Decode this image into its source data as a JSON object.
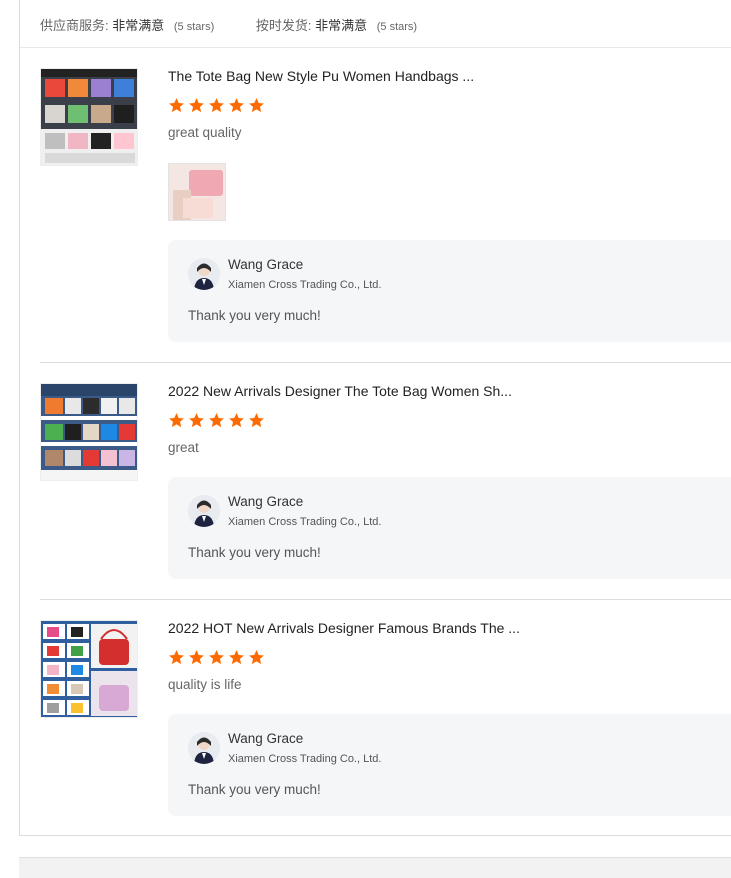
{
  "summary": {
    "supplier_service_label": "供应商服务:",
    "supplier_service_value": "非常满意",
    "supplier_service_note": "(5 stars)",
    "shipping_label": "按时发货:",
    "shipping_value": "非常满意",
    "shipping_note": "(5 stars)"
  },
  "colors": {
    "star": "#ff6a00",
    "reply_bg": "#f4f6f8"
  },
  "reviews": [
    {
      "product_title": "The Tote Bag New Style Pu Women Handbags ...",
      "rating": 5,
      "comment": "great quality",
      "reply": {
        "name": "Wang Grace",
        "company": "Xiamen Cross Trading Co., Ltd.",
        "text": "Thank you very much!"
      }
    },
    {
      "product_title": "2022 New Arrivals Designer The Tote Bag Women Sh...",
      "rating": 5,
      "comment": "great",
      "reply": {
        "name": "Wang Grace",
        "company": "Xiamen Cross Trading Co., Ltd.",
        "text": "Thank you very much!"
      }
    },
    {
      "product_title": "2022 HOT New Arrivals Designer Famous Brands The ...",
      "rating": 5,
      "comment": "quality is life",
      "reply": {
        "name": "Wang Grace",
        "company": "Xiamen Cross Trading Co., Ltd.",
        "text": "Thank you very much!"
      }
    }
  ]
}
